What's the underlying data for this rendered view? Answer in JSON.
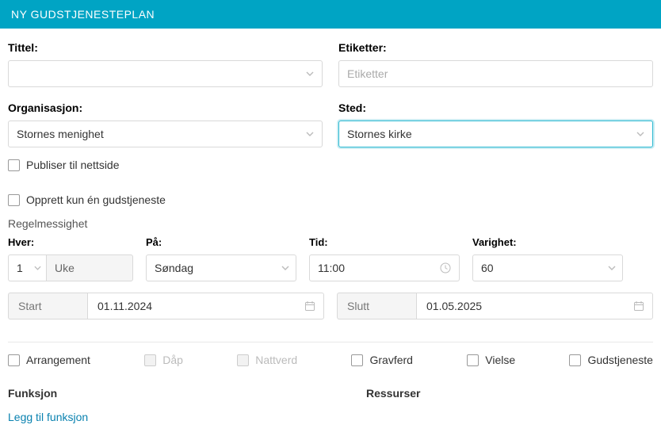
{
  "header": {
    "title": "NY GUDSTJENESTEPLAN"
  },
  "tittel": {
    "label": "Tittel:"
  },
  "etiketter": {
    "label": "Etiketter:",
    "placeholder": "Etiketter"
  },
  "organisasjon": {
    "label": "Organisasjon:",
    "value": "Stornes menighet"
  },
  "sted": {
    "label": "Sted:",
    "value": "Stornes kirke"
  },
  "publiser": {
    "label": "Publiser til nettside"
  },
  "opprett_en": {
    "label": "Opprett kun én gudstjeneste"
  },
  "regelmessighet": {
    "label": "Regelmessighet"
  },
  "hver": {
    "label": "Hver:",
    "num": "1",
    "unit": "Uke"
  },
  "pa": {
    "label": "På:",
    "value": "Søndag"
  },
  "tid": {
    "label": "Tid:",
    "value": "11:00"
  },
  "varighet": {
    "label": "Varighet:",
    "value": "60"
  },
  "start": {
    "label": "Start",
    "value": "01.11.2024"
  },
  "slutt": {
    "label": "Slutt",
    "value": "01.05.2025"
  },
  "types": {
    "arrangement": "Arrangement",
    "dap": "Dåp",
    "nattverd": "Nattverd",
    "gravferd": "Gravferd",
    "vielse": "Vielse",
    "gudstjeneste": "Gudstjeneste"
  },
  "funksjon": {
    "label": "Funksjon",
    "link": "Legg til funksjon"
  },
  "ressurser": {
    "label": "Ressurser"
  }
}
